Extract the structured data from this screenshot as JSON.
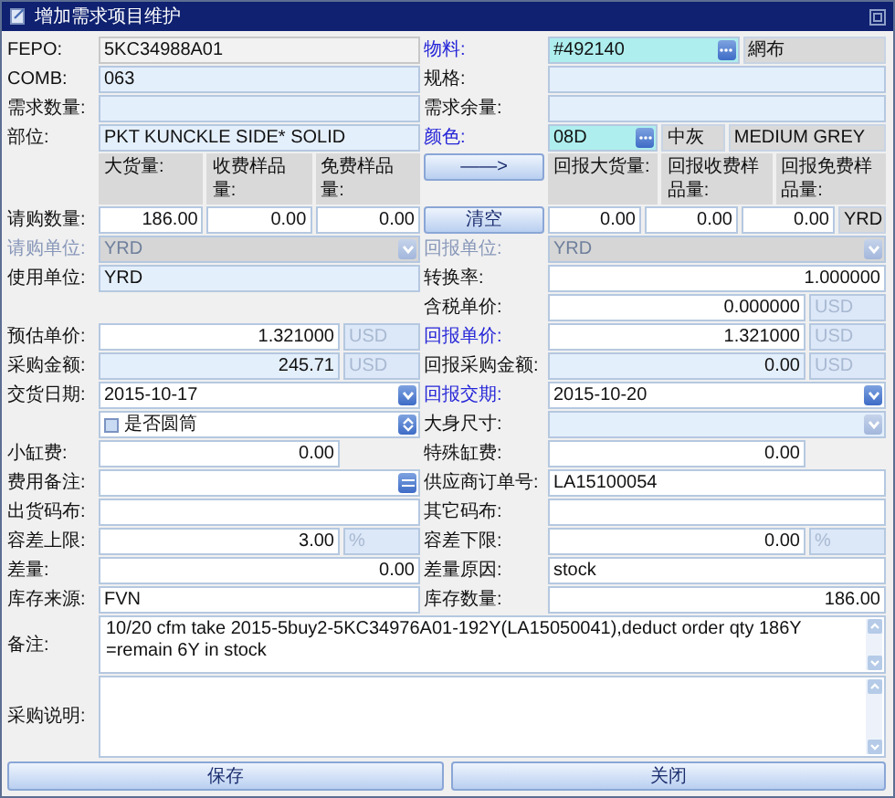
{
  "window": {
    "title": "增加需求项目维护"
  },
  "form_rows": [
    {
      "left": {
        "label": "FEPO:",
        "link": false,
        "disabled": false,
        "fields": [
          {
            "kind": "locked",
            "value": "5KC34988A01"
          }
        ]
      },
      "right": {
        "label": "物料:",
        "link": true,
        "disabled": false,
        "fields": [
          {
            "kind": "lookup",
            "value": "#492140"
          },
          {
            "kind": "static",
            "value": "網布"
          }
        ]
      }
    },
    {
      "left": {
        "label": "COMB:",
        "link": false,
        "disabled": false,
        "fields": [
          {
            "kind": "readonly-text",
            "value": "063"
          }
        ]
      },
      "right": {
        "label": "规格:",
        "link": false,
        "disabled": false,
        "fields": [
          {
            "kind": "readonly-text"
          }
        ]
      }
    },
    {
      "left": {
        "label": "需求数量:",
        "link": false,
        "disabled": false,
        "fields": [
          {
            "kind": "readonly-text"
          }
        ]
      },
      "right": {
        "label": "需求余量:",
        "link": false,
        "disabled": false,
        "fields": [
          {
            "kind": "readonly-text"
          }
        ]
      }
    },
    {
      "left": {
        "label": "部位:",
        "link": false,
        "disabled": false,
        "fields": [
          {
            "kind": "readonly-text",
            "value": "PKT KUNCKLE SIDE* SOLID"
          }
        ]
      },
      "right": {
        "label": "颜色:",
        "link": true,
        "disabled": false,
        "fields": [
          {
            "kind": "lookup",
            "value": "08D"
          },
          {
            "kind": "static",
            "value": "中灰"
          },
          {
            "kind": "static",
            "value": "MEDIUM GREY"
          }
        ]
      }
    },
    {
      "left": {
        "fields": [
          {
            "kind": "header",
            "value": "大货量:"
          },
          {
            "kind": "header",
            "value": "收费样品量:"
          },
          {
            "kind": "header",
            "value": "免费样品量:"
          }
        ]
      },
      "right": {
        "button": "——>",
        "fields": [
          {
            "kind": "header",
            "value": "回报大货量:"
          },
          {
            "kind": "header",
            "value": "回报收费样品量:"
          },
          {
            "kind": "header",
            "value": "回报免费样品量:"
          }
        ]
      }
    },
    {
      "left": {
        "label": "请购数量:",
        "link": false,
        "disabled": false,
        "fields": [
          {
            "kind": "number",
            "value": "186.00"
          },
          {
            "kind": "number",
            "value": "0.00"
          },
          {
            "kind": "number",
            "value": "0.00"
          }
        ]
      },
      "right": {
        "button": "清空",
        "fields": [
          {
            "kind": "number",
            "value": "0.00"
          },
          {
            "kind": "number",
            "value": "0.00"
          },
          {
            "kind": "number",
            "value": "0.00"
          },
          {
            "kind": "static-unit",
            "value": "YRD"
          }
        ]
      }
    },
    {
      "left": {
        "label": "请购单位:",
        "link": false,
        "disabled": true,
        "fields": [
          {
            "kind": "dropdown",
            "value": "YRD",
            "disabled": true
          }
        ]
      },
      "right": {
        "label": "回报单位:",
        "link": false,
        "disabled": true,
        "fields": [
          {
            "kind": "dropdown",
            "value": "YRD",
            "disabled": true
          }
        ]
      }
    },
    {
      "left": {
        "label": "使用单位:",
        "link": false,
        "disabled": false,
        "fields": [
          {
            "kind": "readonly-text",
            "value": "YRD"
          }
        ]
      },
      "right": {
        "label": "转换率:",
        "link": false,
        "disabled": false,
        "fields": [
          {
            "kind": "number",
            "value": "1.000000"
          }
        ]
      }
    },
    {
      "right": {
        "label": "含税单价:",
        "link": false,
        "disabled": false,
        "fields": [
          {
            "kind": "number",
            "value": "0.000000"
          },
          {
            "kind": "unit",
            "value": "USD"
          }
        ]
      }
    },
    {
      "left": {
        "label": "预估单价:",
        "link": false,
        "disabled": false,
        "fields": [
          {
            "kind": "number",
            "value": "1.321000"
          },
          {
            "kind": "unit",
            "value": "USD"
          }
        ]
      },
      "right": {
        "label": "回报单价:",
        "link": true,
        "disabled": false,
        "fields": [
          {
            "kind": "number",
            "value": "1.321000"
          },
          {
            "kind": "unit",
            "value": "USD"
          }
        ]
      }
    },
    {
      "left": {
        "label": "采购金额:",
        "link": false,
        "disabled": false,
        "fields": [
          {
            "kind": "readonly-number",
            "value": "245.71"
          },
          {
            "kind": "unit",
            "value": "USD"
          }
        ]
      },
      "right": {
        "label": "回报采购金额:",
        "link": false,
        "disabled": false,
        "fields": [
          {
            "kind": "readonly-number",
            "value": "0.00"
          },
          {
            "kind": "unit",
            "value": "USD"
          }
        ]
      }
    },
    {
      "left": {
        "label": "交货日期:",
        "link": false,
        "disabled": false,
        "fields": [
          {
            "kind": "dropdown",
            "value": "2015-10-17",
            "disabled": false
          }
        ]
      },
      "right": {
        "label": "回报交期:",
        "link": true,
        "disabled": false,
        "fields": [
          {
            "kind": "dropdown",
            "value": "2015-10-20",
            "disabled": false
          }
        ]
      }
    },
    {
      "left": {
        "fields": [
          {
            "kind": "check-spin",
            "value": "是否圆筒",
            "checked": false
          }
        ]
      },
      "right": {
        "label": "大身尺寸:",
        "link": false,
        "disabled": false,
        "fields": [
          {
            "kind": "readonly-dropdown",
            "disabled": true
          }
        ]
      }
    },
    {
      "left": {
        "label": "小缸费:",
        "link": false,
        "disabled": false,
        "fields": [
          {
            "kind": "number",
            "value": "0.00"
          },
          {
            "kind": "gap"
          }
        ]
      },
      "right": {
        "label": "特殊缸费:",
        "link": false,
        "disabled": false,
        "fields": [
          {
            "kind": "number",
            "value": "0.00"
          },
          {
            "kind": "gap"
          }
        ]
      }
    },
    {
      "left": {
        "label": "费用备注:",
        "link": false,
        "disabled": false,
        "fields": [
          {
            "kind": "text-button"
          }
        ]
      },
      "right": {
        "label": "供应商订单号:",
        "link": false,
        "disabled": false,
        "fields": [
          {
            "kind": "text",
            "value": "LA15100054"
          }
        ]
      }
    },
    {
      "left": {
        "label": "出货码布:",
        "link": false,
        "disabled": false,
        "fields": [
          {
            "kind": "text"
          }
        ]
      },
      "right": {
        "label": "其它码布:",
        "link": false,
        "disabled": false,
        "fields": [
          {
            "kind": "text"
          }
        ]
      }
    },
    {
      "left": {
        "label": "容差上限:",
        "link": false,
        "disabled": false,
        "fields": [
          {
            "kind": "number",
            "value": "3.00"
          },
          {
            "kind": "unit",
            "value": "%"
          }
        ]
      },
      "right": {
        "label": "容差下限:",
        "link": false,
        "disabled": false,
        "fields": [
          {
            "kind": "number",
            "value": "0.00"
          },
          {
            "kind": "unit",
            "value": "%"
          }
        ]
      }
    },
    {
      "left": {
        "label": "差量:",
        "link": false,
        "disabled": false,
        "fields": [
          {
            "kind": "number",
            "value": "0.00"
          }
        ]
      },
      "right": {
        "label": "差量原因:",
        "link": false,
        "disabled": false,
        "fields": [
          {
            "kind": "text",
            "value": "stock"
          }
        ]
      }
    },
    {
      "left": {
        "label": "库存来源:",
        "link": false,
        "disabled": false,
        "fields": [
          {
            "kind": "text",
            "value": "FVN"
          }
        ]
      },
      "right": {
        "label": "库存数量:",
        "link": false,
        "disabled": false,
        "fields": [
          {
            "kind": "number",
            "value": "186.00"
          }
        ]
      }
    }
  ],
  "memos": [
    {
      "label": "备注:",
      "value": "10/20 cfm take 2015-5buy2-5KC34976A01-192Y(LA15050041),deduct order qty 186Y =remain 6Y in stock"
    },
    {
      "label": "采购说明:"
    }
  ],
  "buttons": [
    "保存",
    "关闭"
  ]
}
